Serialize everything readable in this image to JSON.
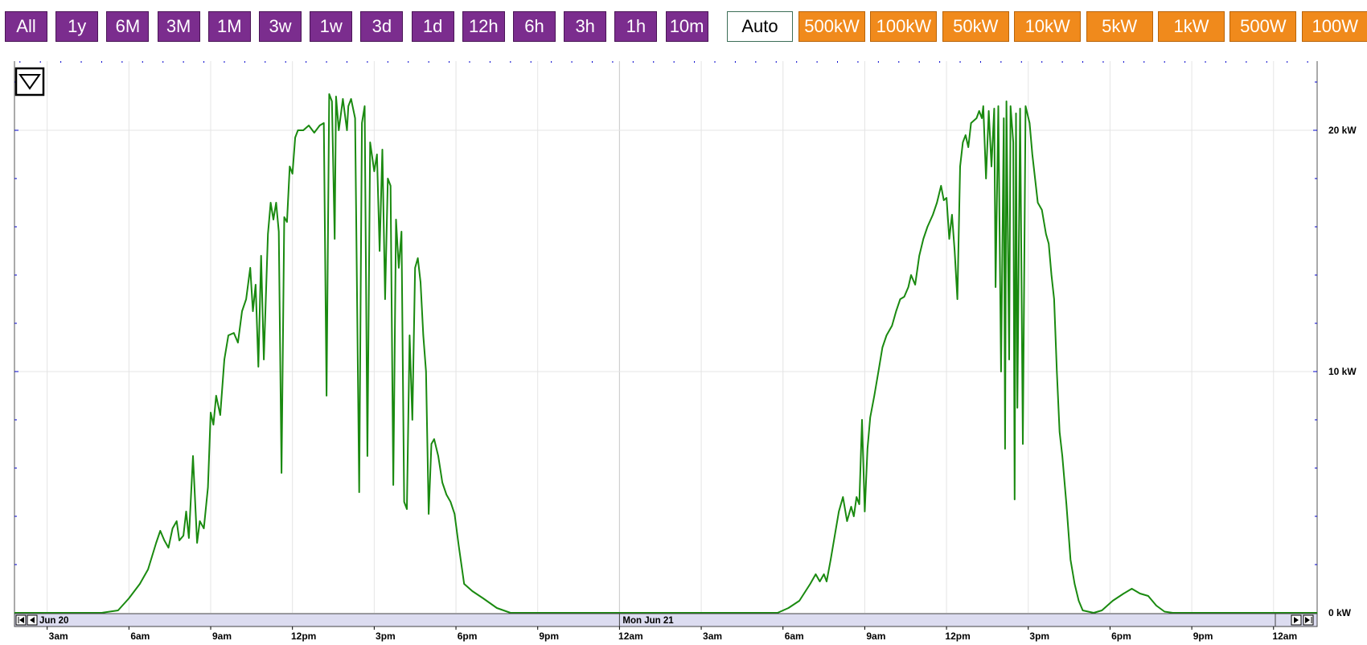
{
  "toolbar": {
    "time_buttons": [
      "All",
      "1y",
      "6M",
      "3M",
      "1M",
      "3w",
      "1w",
      "3d",
      "1d",
      "12h",
      "6h",
      "3h",
      "1h",
      "10m"
    ],
    "auto_label": "Auto",
    "scale_buttons": [
      "500kW",
      "100kW",
      "50kW",
      "10kW",
      "5kW",
      "1kW",
      "500W",
      "100W"
    ]
  },
  "colors": {
    "line": "#1a8a10",
    "time_button": "#7b2d8e",
    "scale_button": "#f08a1c",
    "nav_bar": "#dcdcf0",
    "tick_marks": "#0000cc"
  },
  "icons": {
    "menu": "triangle-down-icon",
    "nav_left": "skip-back-icon",
    "nav_right": "skip-forward-icon"
  },
  "chart_data": {
    "type": "line",
    "y_unit": "kW",
    "ylim": [
      0,
      22
    ],
    "y_ticks": [
      {
        "value": 0,
        "label": "0 kW"
      },
      {
        "value": 10,
        "label": "10 kW"
      },
      {
        "value": 20,
        "label": "20 kW"
      }
    ],
    "x_range_hours": [
      1.8,
      49.6
    ],
    "x_ticks": [
      {
        "hour": 3,
        "label": "3am"
      },
      {
        "hour": 6,
        "label": "6am"
      },
      {
        "hour": 9,
        "label": "9am"
      },
      {
        "hour": 12,
        "label": "12pm"
      },
      {
        "hour": 15,
        "label": "3pm"
      },
      {
        "hour": 18,
        "label": "6pm"
      },
      {
        "hour": 21,
        "label": "9pm"
      },
      {
        "hour": 24,
        "label": "12am"
      },
      {
        "hour": 27,
        "label": "3am"
      },
      {
        "hour": 30,
        "label": "6am"
      },
      {
        "hour": 33,
        "label": "9am"
      },
      {
        "hour": 36,
        "label": "12pm"
      },
      {
        "hour": 39,
        "label": "3pm"
      },
      {
        "hour": 42,
        "label": "6pm"
      },
      {
        "hour": 45,
        "label": "9pm"
      },
      {
        "hour": 48,
        "label": "12am"
      }
    ],
    "day_labels": [
      {
        "hour": 2.0,
        "label": "Jun 20"
      },
      {
        "hour": 24.0,
        "label": "Mon Jun 21"
      }
    ],
    "grid": true,
    "series": [
      {
        "color": "#1a8a10",
        "points": [
          [
            1.8,
            0
          ],
          [
            5.0,
            0
          ],
          [
            5.6,
            0.1
          ],
          [
            6.0,
            0.6
          ],
          [
            6.4,
            1.2
          ],
          [
            6.7,
            1.8
          ],
          [
            7.0,
            2.9
          ],
          [
            7.15,
            3.4
          ],
          [
            7.3,
            3.0
          ],
          [
            7.45,
            2.7
          ],
          [
            7.6,
            3.5
          ],
          [
            7.75,
            3.8
          ],
          [
            7.85,
            3.0
          ],
          [
            8.0,
            3.2
          ],
          [
            8.1,
            4.2
          ],
          [
            8.2,
            3.1
          ],
          [
            8.35,
            6.5
          ],
          [
            8.5,
            2.9
          ],
          [
            8.6,
            3.8
          ],
          [
            8.75,
            3.5
          ],
          [
            8.9,
            5.2
          ],
          [
            9.0,
            8.3
          ],
          [
            9.1,
            7.8
          ],
          [
            9.2,
            9.0
          ],
          [
            9.35,
            8.2
          ],
          [
            9.5,
            10.5
          ],
          [
            9.65,
            11.5
          ],
          [
            9.85,
            11.6
          ],
          [
            10.0,
            11.2
          ],
          [
            10.15,
            12.5
          ],
          [
            10.3,
            13.0
          ],
          [
            10.45,
            14.3
          ],
          [
            10.55,
            12.5
          ],
          [
            10.65,
            13.6
          ],
          [
            10.75,
            10.2
          ],
          [
            10.85,
            14.8
          ],
          [
            10.95,
            10.5
          ],
          [
            11.1,
            15.7
          ],
          [
            11.2,
            17.0
          ],
          [
            11.3,
            16.3
          ],
          [
            11.4,
            17.0
          ],
          [
            11.5,
            15.8
          ],
          [
            11.6,
            5.8
          ],
          [
            11.7,
            16.4
          ],
          [
            11.8,
            16.2
          ],
          [
            11.9,
            18.5
          ],
          [
            12.0,
            18.2
          ],
          [
            12.1,
            19.7
          ],
          [
            12.2,
            20.0
          ],
          [
            12.4,
            20.0
          ],
          [
            12.6,
            20.2
          ],
          [
            12.8,
            19.9
          ],
          [
            13.0,
            20.2
          ],
          [
            13.15,
            20.3
          ],
          [
            13.25,
            9.0
          ],
          [
            13.35,
            21.5
          ],
          [
            13.45,
            21.2
          ],
          [
            13.55,
            15.5
          ],
          [
            13.6,
            21.4
          ],
          [
            13.7,
            20.0
          ],
          [
            13.85,
            21.3
          ],
          [
            14.0,
            20.0
          ],
          [
            14.05,
            21.0
          ],
          [
            14.15,
            21.3
          ],
          [
            14.3,
            20.5
          ],
          [
            14.45,
            5.0
          ],
          [
            14.55,
            20.3
          ],
          [
            14.65,
            21.0
          ],
          [
            14.75,
            6.5
          ],
          [
            14.85,
            19.5
          ],
          [
            15.0,
            18.3
          ],
          [
            15.1,
            19.0
          ],
          [
            15.2,
            15.0
          ],
          [
            15.3,
            19.2
          ],
          [
            15.4,
            13.0
          ],
          [
            15.5,
            18.0
          ],
          [
            15.6,
            17.7
          ],
          [
            15.7,
            5.3
          ],
          [
            15.8,
            16.3
          ],
          [
            15.9,
            14.3
          ],
          [
            16.0,
            15.8
          ],
          [
            16.1,
            4.6
          ],
          [
            16.2,
            4.3
          ],
          [
            16.3,
            11.5
          ],
          [
            16.4,
            8.0
          ],
          [
            16.5,
            14.3
          ],
          [
            16.6,
            14.7
          ],
          [
            16.7,
            13.7
          ],
          [
            16.8,
            11.5
          ],
          [
            16.9,
            10.0
          ],
          [
            17.0,
            4.1
          ],
          [
            17.1,
            7.0
          ],
          [
            17.2,
            7.2
          ],
          [
            17.35,
            6.5
          ],
          [
            17.5,
            5.4
          ],
          [
            17.65,
            4.9
          ],
          [
            17.8,
            4.6
          ],
          [
            17.95,
            4.1
          ],
          [
            18.1,
            2.8
          ],
          [
            18.3,
            1.2
          ],
          [
            18.6,
            0.9
          ],
          [
            19.0,
            0.6
          ],
          [
            19.5,
            0.2
          ],
          [
            20.0,
            0
          ],
          [
            29.8,
            0
          ],
          [
            30.2,
            0.2
          ],
          [
            30.6,
            0.5
          ],
          [
            31.0,
            1.2
          ],
          [
            31.2,
            1.6
          ],
          [
            31.35,
            1.3
          ],
          [
            31.5,
            1.6
          ],
          [
            31.6,
            1.3
          ],
          [
            31.75,
            2.2
          ],
          [
            31.9,
            3.2
          ],
          [
            32.05,
            4.2
          ],
          [
            32.2,
            4.8
          ],
          [
            32.35,
            3.8
          ],
          [
            32.5,
            4.4
          ],
          [
            32.6,
            4.0
          ],
          [
            32.7,
            4.8
          ],
          [
            32.8,
            4.5
          ],
          [
            32.9,
            8.0
          ],
          [
            33.0,
            4.2
          ],
          [
            33.1,
            6.8
          ],
          [
            33.2,
            8.1
          ],
          [
            33.35,
            9.0
          ],
          [
            33.5,
            10.0
          ],
          [
            33.65,
            11.0
          ],
          [
            33.8,
            11.5
          ],
          [
            34.0,
            11.9
          ],
          [
            34.15,
            12.5
          ],
          [
            34.3,
            13.0
          ],
          [
            34.45,
            13.1
          ],
          [
            34.6,
            13.5
          ],
          [
            34.7,
            14.0
          ],
          [
            34.85,
            13.6
          ],
          [
            35.0,
            14.8
          ],
          [
            35.15,
            15.5
          ],
          [
            35.3,
            16.0
          ],
          [
            35.5,
            16.5
          ],
          [
            35.65,
            17.0
          ],
          [
            35.8,
            17.7
          ],
          [
            35.9,
            17.1
          ],
          [
            36.0,
            17.2
          ],
          [
            36.1,
            15.5
          ],
          [
            36.2,
            16.5
          ],
          [
            36.3,
            15.0
          ],
          [
            36.4,
            13.0
          ],
          [
            36.5,
            18.5
          ],
          [
            36.6,
            19.5
          ],
          [
            36.7,
            19.8
          ],
          [
            36.8,
            19.3
          ],
          [
            36.9,
            20.3
          ],
          [
            37.0,
            20.4
          ],
          [
            37.1,
            20.5
          ],
          [
            37.2,
            20.8
          ],
          [
            37.3,
            20.5
          ],
          [
            37.35,
            21.0
          ],
          [
            37.45,
            18.0
          ],
          [
            37.55,
            20.8
          ],
          [
            37.65,
            18.5
          ],
          [
            37.75,
            20.9
          ],
          [
            37.8,
            13.5
          ],
          [
            37.9,
            21.0
          ],
          [
            38.0,
            10.0
          ],
          [
            38.1,
            20.5
          ],
          [
            38.15,
            6.8
          ],
          [
            38.2,
            21.2
          ],
          [
            38.3,
            10.5
          ],
          [
            38.35,
            21.0
          ],
          [
            38.45,
            19.5
          ],
          [
            38.5,
            4.7
          ],
          [
            38.55,
            20.7
          ],
          [
            38.6,
            8.5
          ],
          [
            38.7,
            20.9
          ],
          [
            38.8,
            7.0
          ],
          [
            38.9,
            21.0
          ],
          [
            39.05,
            20.3
          ],
          [
            39.15,
            19.0
          ],
          [
            39.25,
            18.0
          ],
          [
            39.35,
            17.0
          ],
          [
            39.5,
            16.7
          ],
          [
            39.65,
            15.7
          ],
          [
            39.75,
            15.3
          ],
          [
            39.85,
            14.0
          ],
          [
            39.95,
            13.0
          ],
          [
            40.05,
            10.0
          ],
          [
            40.15,
            7.5
          ],
          [
            40.25,
            6.5
          ],
          [
            40.4,
            4.5
          ],
          [
            40.55,
            2.2
          ],
          [
            40.7,
            1.2
          ],
          [
            40.85,
            0.5
          ],
          [
            41.0,
            0.1
          ],
          [
            41.4,
            0
          ],
          [
            41.7,
            0.1
          ],
          [
            42.1,
            0.5
          ],
          [
            42.5,
            0.8
          ],
          [
            42.8,
            1.0
          ],
          [
            43.1,
            0.8
          ],
          [
            43.4,
            0.7
          ],
          [
            43.7,
            0.3
          ],
          [
            44.0,
            0.05
          ],
          [
            44.3,
            0
          ],
          [
            49.6,
            0
          ]
        ]
      }
    ]
  }
}
